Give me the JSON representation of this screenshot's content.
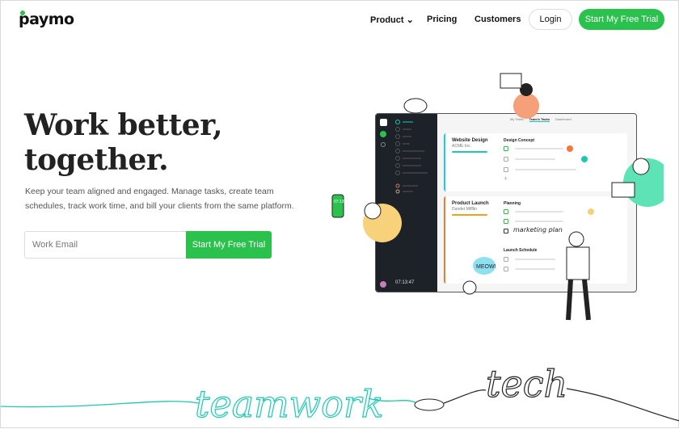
{
  "brand": "paymo",
  "nav": {
    "product": "Product ⌄",
    "pricing": "Pricing",
    "customers": "Customers",
    "login": "Login",
    "trial": "Start My Free Trial"
  },
  "hero": {
    "title_line1": "Work better,",
    "title_line2": "together.",
    "subtitle": "Keep your team aligned and engaged. Manage tasks, create team schedules, track work time, and bill your clients from the same platform.",
    "email_placeholder": "Work Email",
    "cta": "Start My Free Trial"
  },
  "mockup": {
    "tabs": [
      "My Tasks",
      "Team's Tasks",
      "Dashboard"
    ],
    "projects": [
      {
        "name": "Website Design",
        "client": "ACME Inc.",
        "list": "Design Concept"
      },
      {
        "name": "Product Launch",
        "client": "Dunder Mifflin",
        "list": "Planning",
        "list2": "Launch Schedule"
      }
    ],
    "handwritten_task": "marketing plan",
    "timer": "07:13:47",
    "bubble": "MEOW!",
    "phone_timer": "07:13"
  },
  "footer_art": {
    "left": "teamwork",
    "right": "tech"
  },
  "colors": {
    "accent": "#2ac14c",
    "teal": "#1ec8b0",
    "orange": "#f07a3c"
  }
}
